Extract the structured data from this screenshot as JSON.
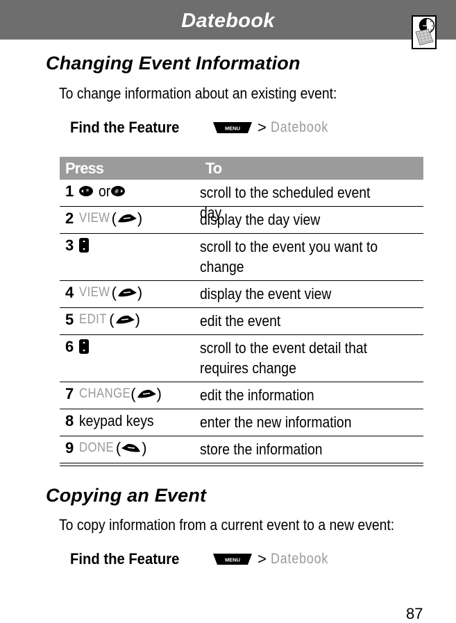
{
  "header": {
    "title": "Datebook",
    "icon": "datebook-calendar-clock-icon"
  },
  "sections": [
    {
      "title": "Changing Event Information",
      "intro": "To change information about an existing event:",
      "find_feature": {
        "label": "Find the Feature",
        "menu_key": "MENU",
        "separator": ">",
        "path": "Datebook"
      }
    },
    {
      "title": "Copying an Event",
      "intro": "To copy information from a current event to a new event:",
      "find_feature": {
        "label": "Find the Feature",
        "menu_key": "MENU",
        "separator": ">",
        "path": "Datebook"
      }
    }
  ],
  "table": {
    "headers": [
      "Press",
      "To"
    ],
    "rows": [
      {
        "step": "1",
        "press_type": "nav-keys",
        "press_text": "or",
        "press_icons": [
          "left-star-key-icon",
          "hash-right-key-icon"
        ],
        "to": "scroll to the scheduled event day"
      },
      {
        "step": "2",
        "press_type": "softkey",
        "press_text": "VIEW",
        "softkey_icon": "right-soft-key-icon",
        "to": "display the day view"
      },
      {
        "step": "3",
        "press_type": "scroll",
        "press_icons": [
          "scroll-up-down-key-icon"
        ],
        "to": "scroll to the event you want to change"
      },
      {
        "step": "4",
        "press_type": "softkey",
        "press_text": "VIEW",
        "softkey_icon": "right-soft-key-icon",
        "to": "display the event view"
      },
      {
        "step": "5",
        "press_type": "softkey",
        "press_text": "EDIT",
        "softkey_icon": "right-soft-key-icon",
        "to": "edit the event"
      },
      {
        "step": "6",
        "press_type": "scroll",
        "press_icons": [
          "scroll-up-down-key-icon"
        ],
        "to": "scroll to the event detail that requires change"
      },
      {
        "step": "7",
        "press_type": "softkey",
        "press_text": "CHANGE",
        "softkey_icon": "right-soft-key-icon",
        "to": "edit the information"
      },
      {
        "step": "8",
        "press_type": "text",
        "press_text": "keypad keys",
        "to": "enter the new information"
      },
      {
        "step": "9",
        "press_type": "softkey",
        "press_text": "DONE",
        "softkey_icon": "left-soft-key-icon",
        "to": "store the information"
      }
    ]
  },
  "page_number": "87"
}
